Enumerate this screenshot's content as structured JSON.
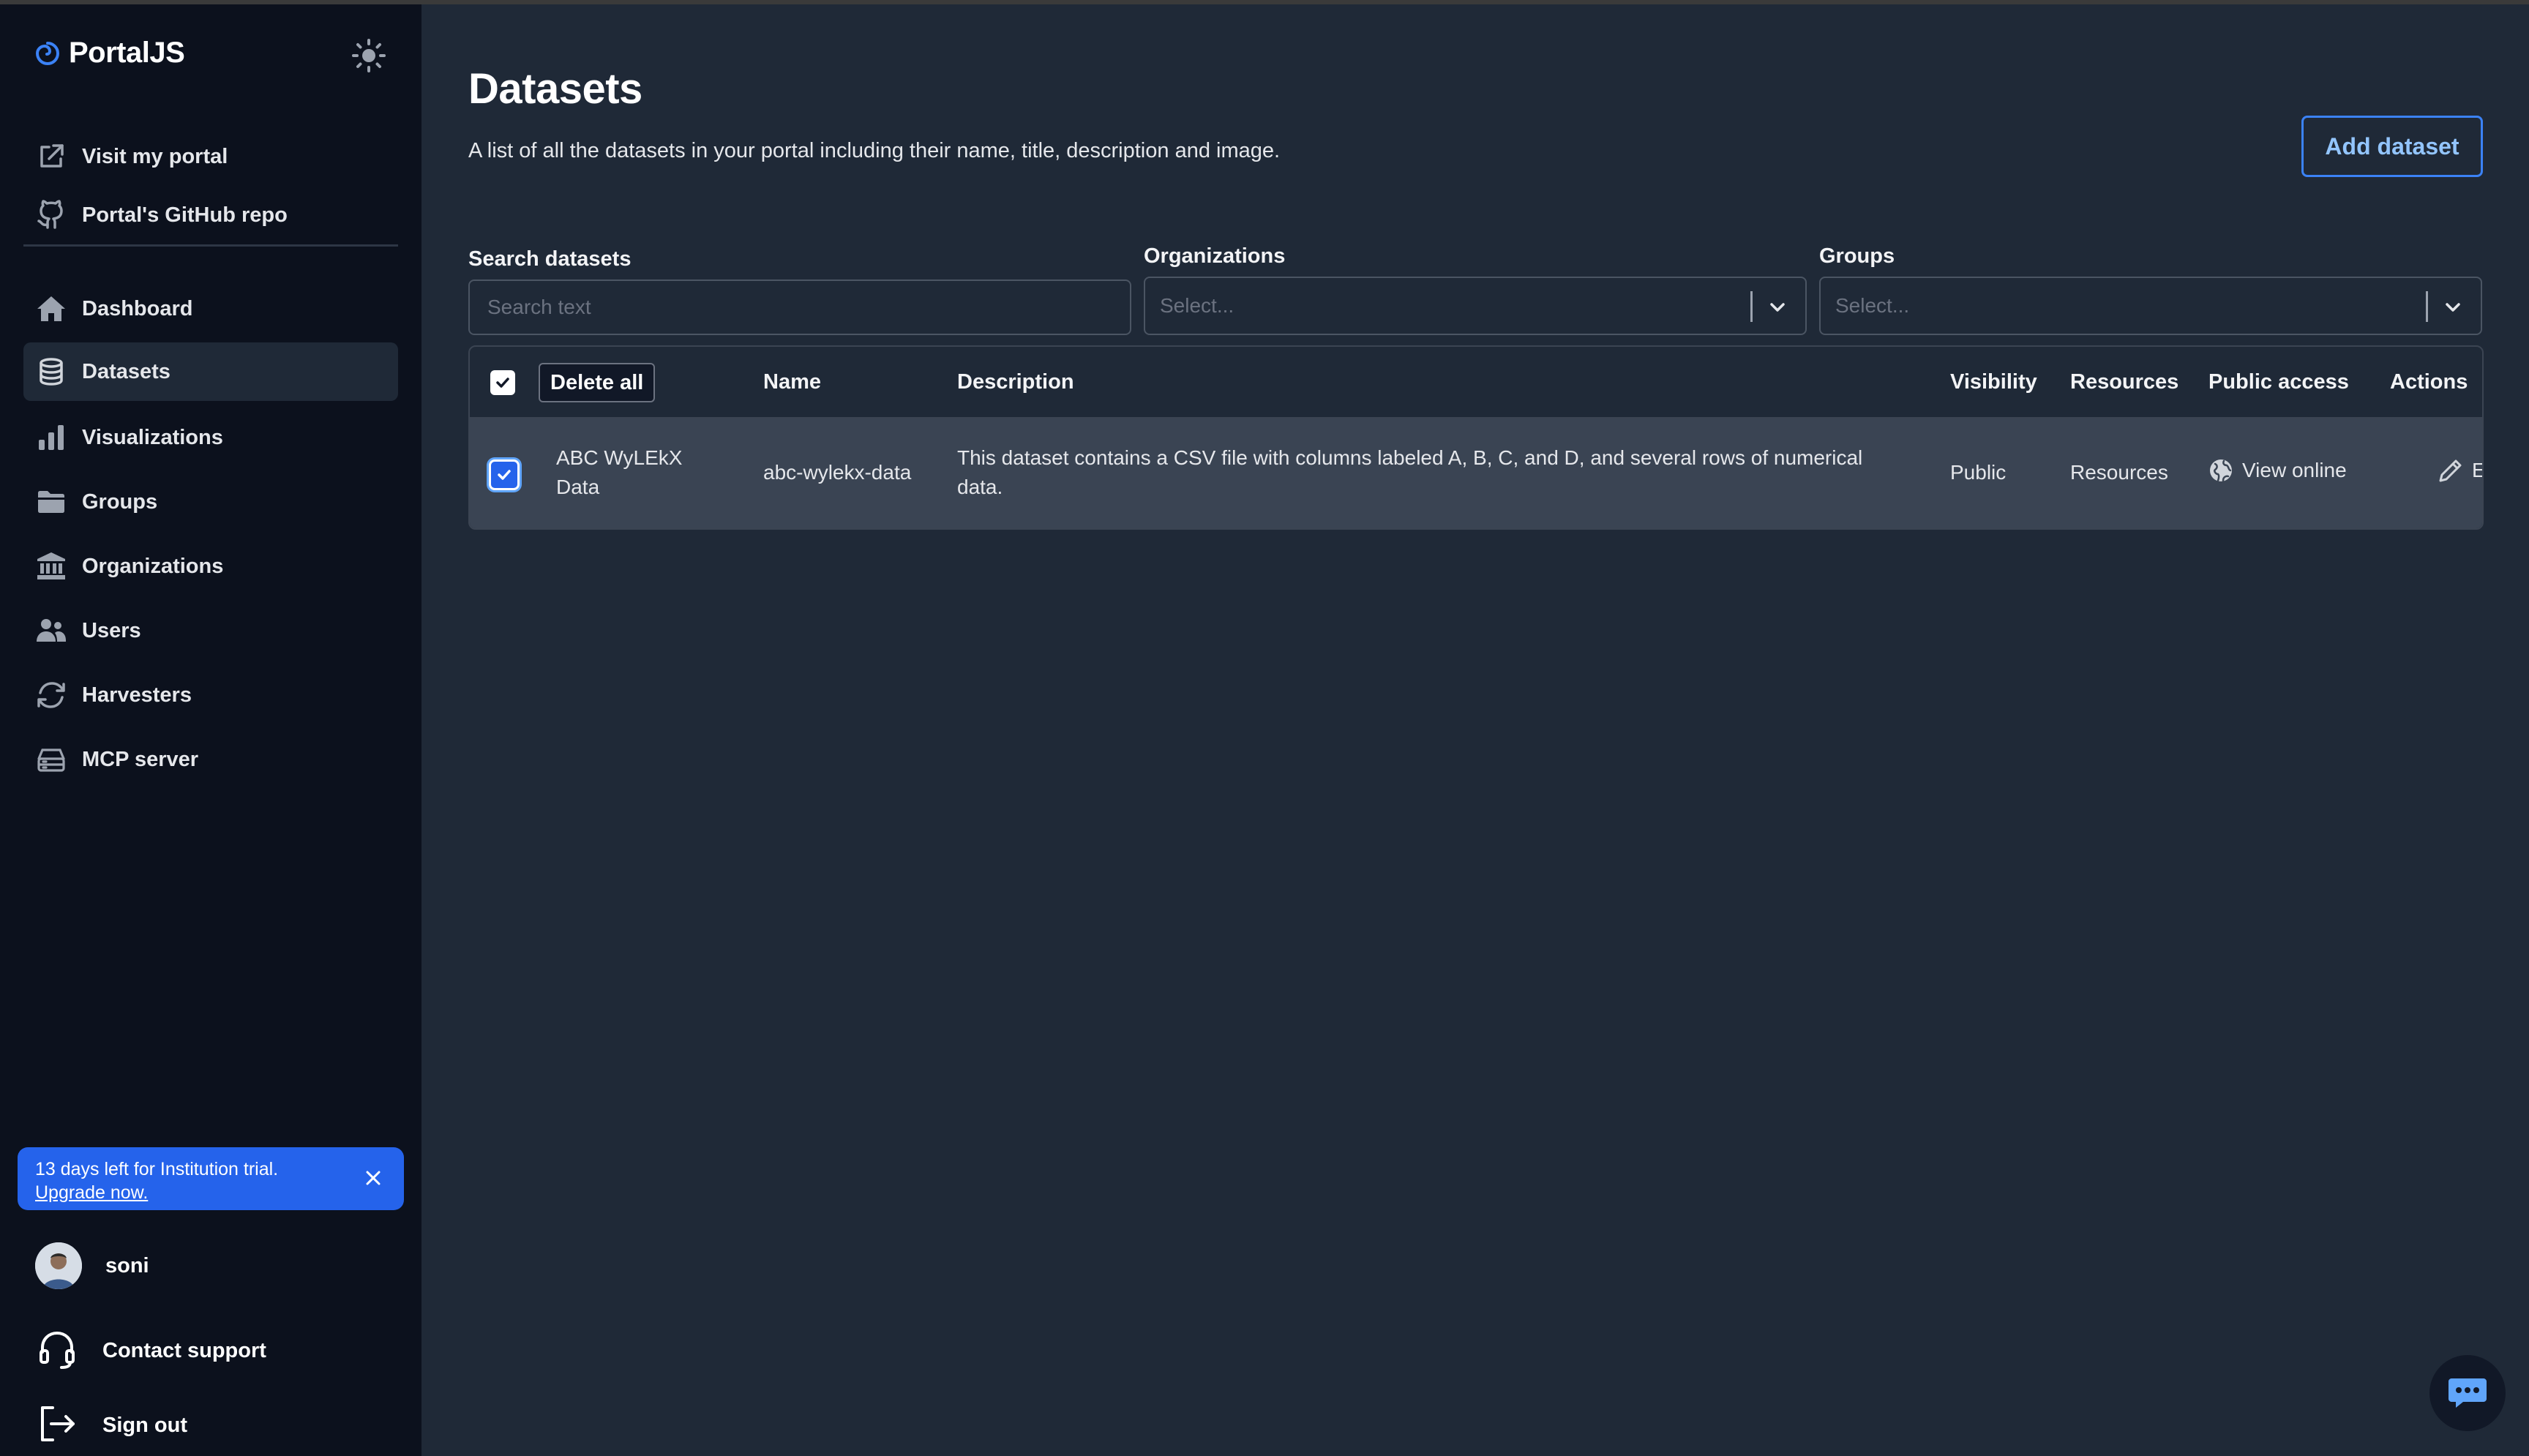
{
  "app": {
    "name": "PortalJS"
  },
  "sidebar": {
    "top_links": [
      {
        "label": "Visit my portal",
        "icon": "external-link-icon"
      },
      {
        "label": "Portal's GitHub repo",
        "icon": "github-icon"
      }
    ],
    "nav": [
      {
        "label": "Dashboard",
        "icon": "home-icon"
      },
      {
        "label": "Datasets",
        "icon": "database-icon",
        "active": true
      },
      {
        "label": "Visualizations",
        "icon": "bar-chart-icon"
      },
      {
        "label": "Groups",
        "icon": "folder-icon"
      },
      {
        "label": "Organizations",
        "icon": "bank-icon"
      },
      {
        "label": "Users",
        "icon": "users-icon"
      },
      {
        "label": "Harvesters",
        "icon": "refresh-icon"
      },
      {
        "label": "MCP server",
        "icon": "server-icon"
      }
    ],
    "trial": {
      "text": "13 days left for Institution trial.",
      "link": "Upgrade now."
    },
    "user": {
      "name": "soni"
    },
    "contact": "Contact support",
    "signout": "Sign out"
  },
  "main": {
    "title": "Datasets",
    "subtitle": "A list of all the datasets in your portal including their name, title, description and image.",
    "add_button": "Add dataset",
    "filters": {
      "search_label": "Search datasets",
      "search_placeholder": "Search text",
      "org_label": "Organizations",
      "org_placeholder": "Select...",
      "groups_label": "Groups",
      "groups_placeholder": "Select..."
    },
    "table": {
      "delete_all": "Delete all",
      "headers": {
        "name": "Name",
        "description": "Description",
        "visibility": "Visibility",
        "resources": "Resources",
        "public_access": "Public access",
        "actions": "Actions"
      },
      "rows": [
        {
          "title_line1": "ABC WyLEkX",
          "title_line2": "Data",
          "name": "abc-wylekx-data",
          "description_line1": "This dataset contains a CSV file with columns labeled A, B, C, and D, and several rows of numerical",
          "description_line2": "data.",
          "visibility": "Public",
          "resources": "Resources",
          "public_access": "View online",
          "action": "Edit"
        }
      ]
    }
  },
  "colors": {
    "accent": "#2563eb",
    "sidebar_bg": "#0c111d",
    "main_bg": "#1f2937"
  }
}
